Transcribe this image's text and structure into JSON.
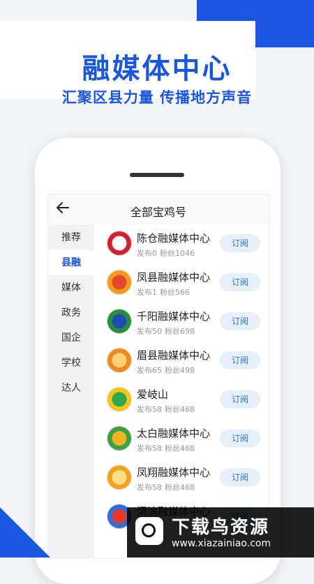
{
  "promo": {
    "headline": "融媒体中心",
    "tagline": "汇聚区县力量 传播地方声音"
  },
  "header": {
    "back_icon": "arrow-left-icon",
    "title": "全部宝鸡号"
  },
  "sidebar": {
    "items": [
      {
        "label": "推荐"
      },
      {
        "label": "县融",
        "active": true
      },
      {
        "label": "媒体"
      },
      {
        "label": "政务"
      },
      {
        "label": "国企"
      },
      {
        "label": "学校"
      },
      {
        "label": "达人"
      }
    ]
  },
  "list": {
    "items": [
      {
        "name": "陈仓融媒体中心",
        "posts": "发布0",
        "fans": "粉丝1046",
        "button": "订阅",
        "colors": [
          "#d32030",
          "#ffffff"
        ]
      },
      {
        "name": "凤县融媒体中心",
        "posts": "发布1",
        "fans": "粉丝566",
        "button": "订阅",
        "colors": [
          "#f29b1b",
          "#e5452a"
        ]
      },
      {
        "name": "千阳融媒体中心",
        "posts": "发布50",
        "fans": "粉丝698",
        "button": "订阅",
        "colors": [
          "#2a8d3e",
          "#1d4fb3"
        ]
      },
      {
        "name": "眉县融媒体中心",
        "posts": "发布65",
        "fans": "粉丝498",
        "button": "订阅",
        "colors": [
          "#f08a1e",
          "#ffd27a"
        ]
      },
      {
        "name": "爱岐山",
        "posts": "发布58",
        "fans": "粉丝468",
        "button": "订阅",
        "colors": [
          "#f6c21c",
          "#2aa84b"
        ]
      },
      {
        "name": "太白融媒体中心",
        "posts": "发布58",
        "fans": "粉丝468",
        "button": "订阅",
        "colors": [
          "#3ea046",
          "#f0b423"
        ]
      },
      {
        "name": "凤翔融媒体中心",
        "posts": "发布58",
        "fans": "粉丝468",
        "button": "订阅",
        "colors": [
          "#f2a120",
          "#ffe083"
        ]
      },
      {
        "name": "渭滨融媒体中心",
        "posts": "",
        "fans": "",
        "button": "订阅",
        "colors": [
          "#2c6fdc",
          "#e23a2a"
        ]
      }
    ]
  },
  "watermark": {
    "title": "下载鸟资源",
    "url": "www.xiazainiao.com"
  },
  "colors": {
    "accent": "#1a56e0",
    "button_bg": "#e6f0fb",
    "button_text": "#2f6fd6"
  }
}
